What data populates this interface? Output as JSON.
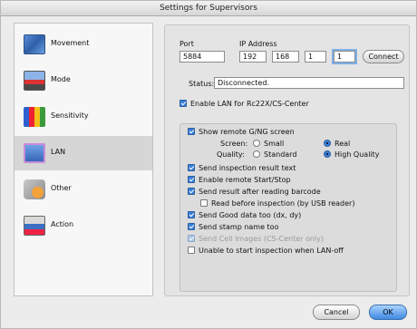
{
  "window": {
    "title": "Settings for Supervisors"
  },
  "sidebar": {
    "items": [
      {
        "label": "Movement",
        "icon": "movement-icon",
        "selected": false
      },
      {
        "label": "Mode",
        "icon": "mode-icon",
        "selected": false
      },
      {
        "label": "Sensitivity",
        "icon": "sensitivity-icon",
        "selected": false
      },
      {
        "label": "LAN",
        "icon": "lan-icon",
        "selected": true
      },
      {
        "label": "Other",
        "icon": "other-icon",
        "selected": false
      },
      {
        "label": "Action",
        "icon": "action-icon",
        "selected": false
      }
    ]
  },
  "lan": {
    "port_label": "Port",
    "port_value": "5884",
    "ip_label": "IP Address",
    "ip": [
      "192",
      "168",
      "1",
      "1"
    ],
    "connect_label": "Connect",
    "status_label": "Status:",
    "status_value": "Disconnected.",
    "enable_label": "Enable LAN for Rc22X/CS-Center",
    "show_remote_label": "Show remote G/NG screen",
    "screen_label": "Screen:",
    "screen_options": [
      "Small",
      "Real"
    ],
    "screen_selected": "Real",
    "quality_label": "Quality:",
    "quality_options": [
      "Standard",
      "High Quality"
    ],
    "quality_selected": "High Quality",
    "send_inspection_label": "Send inspection result text",
    "enable_remote_label": "Enable remote Start/Stop",
    "send_after_barcode_label": "Send result after reading barcode",
    "read_before_label": "Read before inspection (by USB reader)",
    "send_good_label": "Send Good data too (dx, dy)",
    "send_stamp_label": "Send stamp name too",
    "send_cell_label": "Send Cell images (CS-Center only)",
    "unable_label": "Unable to start inspection when LAN-off"
  },
  "footer": {
    "cancel_label": "Cancel",
    "ok_label": "OK"
  },
  "colors": {
    "accent": "#3d7fd9",
    "selected_row": "#d6d6d6"
  }
}
